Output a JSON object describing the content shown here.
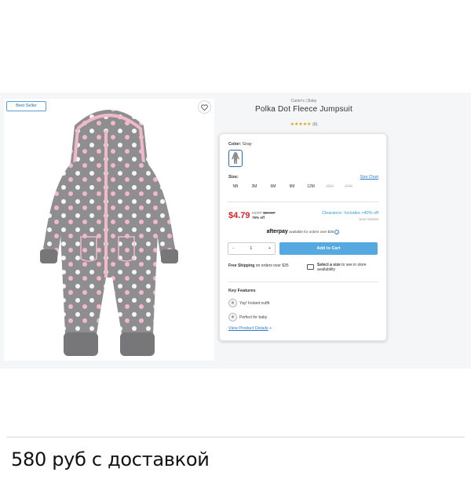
{
  "listing": {
    "badge": "Best Seller",
    "brand": "Carter's | Baby",
    "title": "Polka Dot Fleece Jumpsuit",
    "rating_stars": "★★★★★",
    "rating_count": "(6)",
    "color_label": "Color:",
    "color_value": "Gray",
    "size_label": "Size:",
    "size_chart": "Size Chart",
    "sizes": [
      "NB",
      "3M",
      "6M",
      "9M",
      "12M",
      "18M",
      "24M"
    ],
    "price": "$4.79",
    "msrp_label": "MSRP",
    "msrp": "$20.00*",
    "percent_off": "76% off",
    "clearance": "Clearance: Includes +40% off",
    "dod": "DOD 09/2020",
    "afterpay_logo": "afterpay",
    "afterpay_text": "available for orders over $35",
    "afterpay_info": "i",
    "qty_minus": "-",
    "qty_value": "1",
    "qty_plus": "+",
    "add_to_cart": "Add to Cart",
    "free_shipping_bold": "Free Shipping",
    "free_shipping_rest": "on orders over $35",
    "store_bold": "Select a size",
    "store_rest": "to see in store availability",
    "key_features_title": "Key Features",
    "features": [
      "Yay! Instant outfit",
      "Perfect for baby"
    ],
    "view_details": "View Product Details",
    "view_details_arrow": "+"
  },
  "caption": "580 руб с доставкой",
  "colors": {
    "accent_blue": "#56a8e0",
    "price_red": "#d5232b",
    "garment_gray": "#8e8e90",
    "dot_pink": "#f1b9c7"
  },
  "icons": [
    "heart-icon",
    "star-icon",
    "info-icon",
    "store-icon",
    "feature-icon"
  ]
}
